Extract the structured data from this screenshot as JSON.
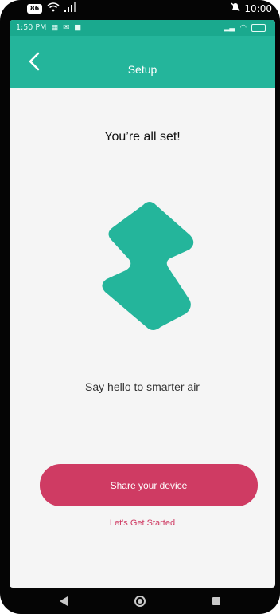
{
  "outer_status": {
    "battery_level": "86",
    "time": "10:00",
    "left_icons": [
      "wifi-icon",
      "signal-icon"
    ],
    "right_icons": [
      "alarm-off-icon"
    ]
  },
  "inner_status": {
    "time": "1:50 PM",
    "left_icons": [
      "notification-icon",
      "mail-icon",
      "video-icon"
    ],
    "right_icons": [
      "signal-icon",
      "wifi-icon",
      "battery-icon"
    ]
  },
  "app_bar": {
    "title": "Setup",
    "back_icon": "chevron-left-icon"
  },
  "content": {
    "title": "You’re all set!",
    "subtitle": "Say hello to smarter air",
    "logo_color": "#24b59b"
  },
  "actions": {
    "primary_label": "Share your device",
    "secondary_label": "Let's Get Started"
  },
  "colors": {
    "accent": "#24b59b",
    "status": "#1aa98e",
    "primary": "#cf3b63"
  },
  "nav": {
    "icons": [
      "back-icon",
      "home-icon",
      "recent-apps-icon"
    ]
  }
}
